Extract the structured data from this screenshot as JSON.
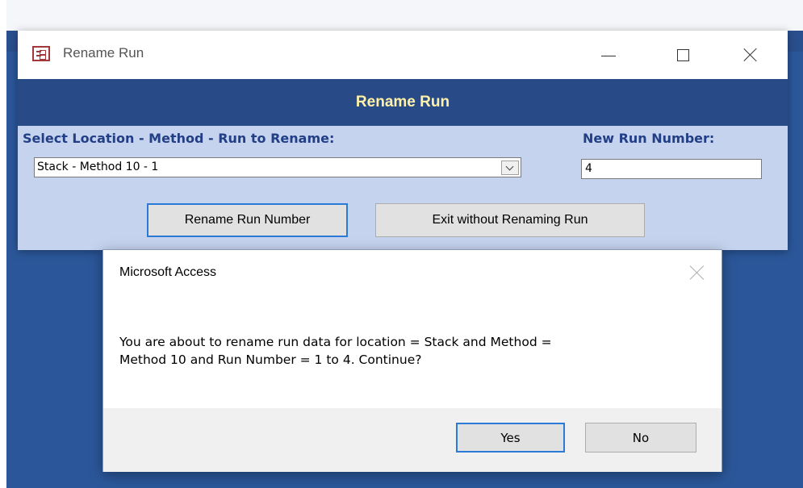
{
  "window": {
    "title": "Rename Run",
    "form_header": "Rename Run",
    "icon": "form-icon",
    "controls": [
      "minimize-icon",
      "maximize-icon",
      "close-icon"
    ]
  },
  "form": {
    "select_label": "Select Location - Method - Run to Rename:",
    "select_value": "Stack - Method 10 - 1",
    "new_run_label": "New Run Number:",
    "new_run_value": "4",
    "rename_button": "Rename Run Number",
    "exit_button": "Exit without Renaming Run"
  },
  "dialog": {
    "title": "Microsoft Access",
    "message_line1": "You are about to rename run data for location = Stack and Method =",
    "message_line2": "Method 10 and Run Number = 1 to 4.  Continue?",
    "yes_button": "Yes",
    "no_button": "No"
  },
  "colors": {
    "form_header_bg": "#284b87",
    "form_header_text": "#fff2a8",
    "form_bg": "#c5d3ef",
    "label_text": "#223f86",
    "focus_border": "#2b7ad6",
    "desktop_bg": "#2b579a"
  }
}
